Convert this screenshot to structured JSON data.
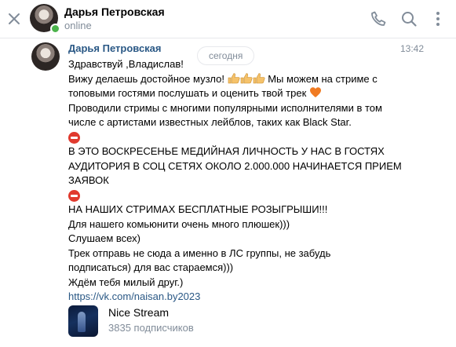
{
  "header": {
    "close_icon": "close-icon",
    "name": "Дарья Петровская",
    "status": "online",
    "actions": [
      "phone-icon",
      "search-icon",
      "more-icon"
    ],
    "online_color": "#4bb34b"
  },
  "chat": {
    "date_separator": "сегодня",
    "message": {
      "author": "Дарья Петровская",
      "time": "13:42",
      "lines": {
        "l1": "Здравствуй ,Владислав!",
        "l2a": "Вижу делаешь достойное музло!",
        "l2b": " Мы можем на стриме с",
        "l3": "топовыми гостями послушать и оценить твой трек",
        "l4": "Проводили стримы с многими популярными исполнителями в том",
        "l5": "числе с артистами известных лейблов, таких как Black Star.",
        "l7": "В ЭТО ВОСКРЕСЕНЬЕ МЕДИЙНАЯ ЛИЧНОСТЬ У НАС В ГОСТЯХ",
        "l8": "АУДИТОРИЯ В СОЦ СЕТЯХ ОКОЛО 2.000.000 НАЧИНАЕТСЯ ПРИЕМ",
        "l9": "ЗАЯВОК",
        "l11": "НА НАШИХ СТРИМАХ БЕСПЛАТНЫЕ РОЗЫГРЫШИ!!!",
        "l12": "Для нашего комьюнити очень много плюшек)))",
        "l13": "Слушаем всех)",
        "l14": "Трек отправь не сюда а именно в ЛС группы, не забудь",
        "l15": "подписаться) для вас стараемся)))",
        "l16": "Ждём тебя милый друг.)"
      },
      "link": "https://vk.com/naisan.by2023"
    },
    "attachment": {
      "group_name": "Nice Stream",
      "subscribers": "3835 подписчиков"
    }
  },
  "colors": {
    "link": "#2a5885",
    "secondary_text": "#818c99",
    "stop_sign": "#e03a2e",
    "heart": "#f07b22",
    "thumbs": "#f5c26b"
  }
}
